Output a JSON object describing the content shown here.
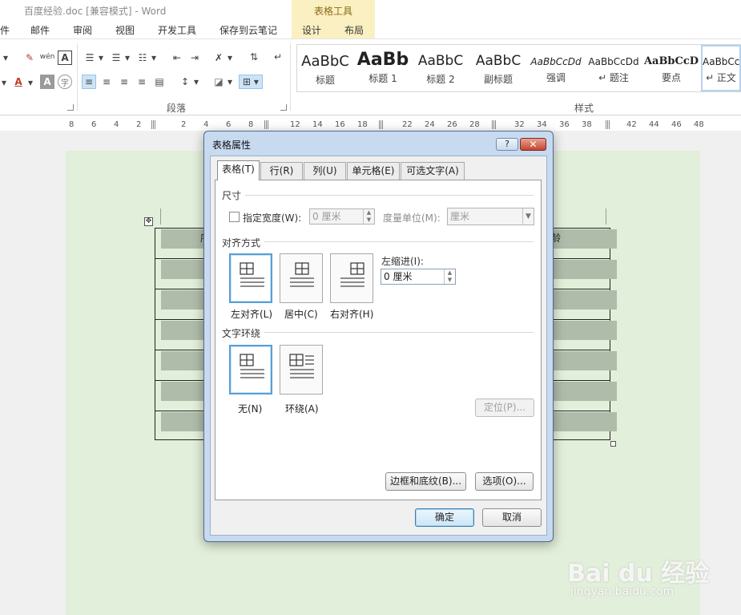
{
  "window": {
    "title": "百度经验.doc [兼容模式] - Word",
    "context_group": "表格工具"
  },
  "tabs": [
    "件",
    "邮件",
    "审阅",
    "视图",
    "开发工具",
    "保存到云笔记",
    "设计",
    "布局"
  ],
  "ribbon": {
    "groups": {
      "paragraph": "段落",
      "styles": "样式"
    },
    "styles": [
      {
        "sample": "AaBbC",
        "name": "标题"
      },
      {
        "sample": "AaBb",
        "name": "标题 1"
      },
      {
        "sample": "AaBbC",
        "name": "标题 2"
      },
      {
        "sample": "AaBbC",
        "name": "副标题"
      },
      {
        "sample": "AaBbCcDd",
        "name": "强调"
      },
      {
        "sample": "AaBbCcDd",
        "name": "↵ 题注"
      },
      {
        "sample": "AaBbCcD",
        "name": "要点"
      },
      {
        "sample": "AaBbCcI",
        "name": "↵ 正文"
      }
    ],
    "icons": {
      "phonetic": "wén",
      "char_border": "A",
      "char_shade": "A",
      "enclose": "字",
      "font_color": "A"
    }
  },
  "ruler": [
    "8",
    "6",
    "4",
    "2",
    "2",
    "4",
    "6",
    "8",
    "12",
    "14",
    "16",
    "18",
    "22",
    "24",
    "26",
    "28",
    "32",
    "34",
    "36",
    "38",
    "42",
    "44",
    "46",
    "48"
  ],
  "document": {
    "col_a": "序",
    "col_b": "龄"
  },
  "dialog": {
    "title": "表格属性",
    "help": "?",
    "close": "✕",
    "tabs": [
      "表格(T)",
      "行(R)",
      "列(U)",
      "单元格(E)",
      "可选文字(A)"
    ],
    "size": {
      "section": "尺寸",
      "preferred_width_label": "指定宽度(W):",
      "preferred_width_value": "0 厘米",
      "measure_label": "度量单位(M):",
      "measure_value": "厘米"
    },
    "alignment": {
      "section": "对齐方式",
      "options": [
        "左对齐(L)",
        "居中(C)",
        "右对齐(H)"
      ],
      "indent_label": "左缩进(I):",
      "indent_value": "0 厘米"
    },
    "wrapping": {
      "section": "文字环绕",
      "options": [
        "无(N)",
        "环绕(A)"
      ],
      "positioning_button": "定位(P)..."
    },
    "borders_button": "边框和底纹(B)...",
    "options_button": "选项(O)...",
    "ok": "确定",
    "cancel": "取消"
  },
  "watermark": {
    "logo": "Bai du 经验",
    "url": "jingyan.baidu.com"
  },
  "colors": {
    "page": "#e2efda",
    "dialog_frame": "#c7daf0",
    "context_tab": "#fbf0c2",
    "accent": "#5a9fd4"
  }
}
